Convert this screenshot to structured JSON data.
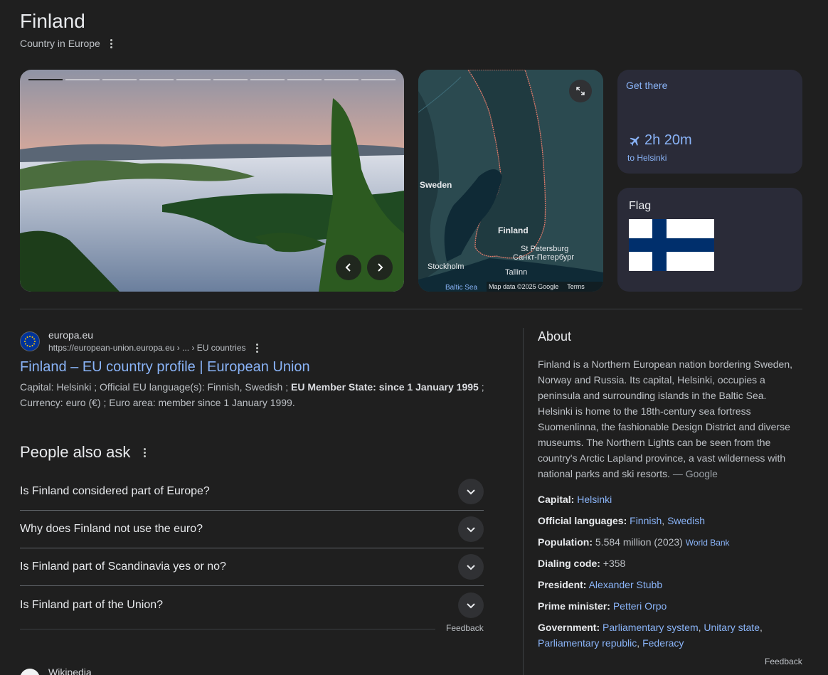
{
  "header": {
    "title": "Finland",
    "subtitle": "Country in Europe"
  },
  "map": {
    "labels": {
      "sweden": "Sweden",
      "finland": "Finland",
      "stpetersburg": "St Petersburg",
      "stpetersburg_ru": "Санкт-Петербург",
      "stockholm": "Stockholm",
      "tallinn": "Tallinn",
      "baltic": "Baltic Sea",
      "mapdata": "Map data ©2025 Google",
      "terms": "Terms"
    }
  },
  "get_there": {
    "label": "Get there",
    "duration": "2h 20m",
    "destination": "to Helsinki"
  },
  "flag": {
    "label": "Flag",
    "colors": {
      "blue": "#002f6c",
      "white": "#ffffff"
    }
  },
  "result": {
    "site_name": "europa.eu",
    "url": "https://european-union.europa.eu › ... › EU countries",
    "title": "Finland – EU country profile | European Union",
    "snippet_pre": "Capital: Helsinki ; Official EU language(s): Finnish, Swedish ; ",
    "snippet_bold": "EU Member State: since 1 January 1995",
    "snippet_post": " ; Currency: euro (€) ; Euro area: member since 1 January 1999."
  },
  "paa": {
    "heading": "People also ask",
    "questions": [
      "Is Finland considered part of Europe?",
      "Why does Finland not use the euro?",
      "Is Finland part of Scandinavia yes or no?",
      "Is Finland part of the Union?"
    ],
    "feedback": "Feedback"
  },
  "next_result": {
    "site_name": "Wikipedia"
  },
  "about": {
    "heading": "About",
    "description": "Finland is a Northern European nation bordering Sweden, Norway and Russia. Its capital, Helsinki, occupies a peninsula and surrounding islands in the Baltic Sea. Helsinki is home to the 18th-century sea fortress Suomenlinna, the fashionable Design District and diverse museums. The Northern Lights can be seen from the country's Arctic Lapland province, a vast wilderness with national parks and ski resorts.",
    "source": "— Google",
    "capital_label": "Capital:",
    "capital": "Helsinki",
    "languages_label": "Official languages:",
    "lang1": "Finnish",
    "lang2": "Swedish",
    "population_label": "Population:",
    "population": "5.584 million (2023)",
    "population_source": "World Bank",
    "dialing_label": "Dialing code:",
    "dialing": "+358",
    "president_label": "President:",
    "president": "Alexander Stubb",
    "pm_label": "Prime minister:",
    "pm": "Petteri Orpo",
    "government_label": "Government:",
    "gov1": "Parliamentary system",
    "gov2": "Unitary state",
    "gov3": "Parliamentary republic",
    "gov4": "Federacy",
    "feedback": "Feedback"
  }
}
